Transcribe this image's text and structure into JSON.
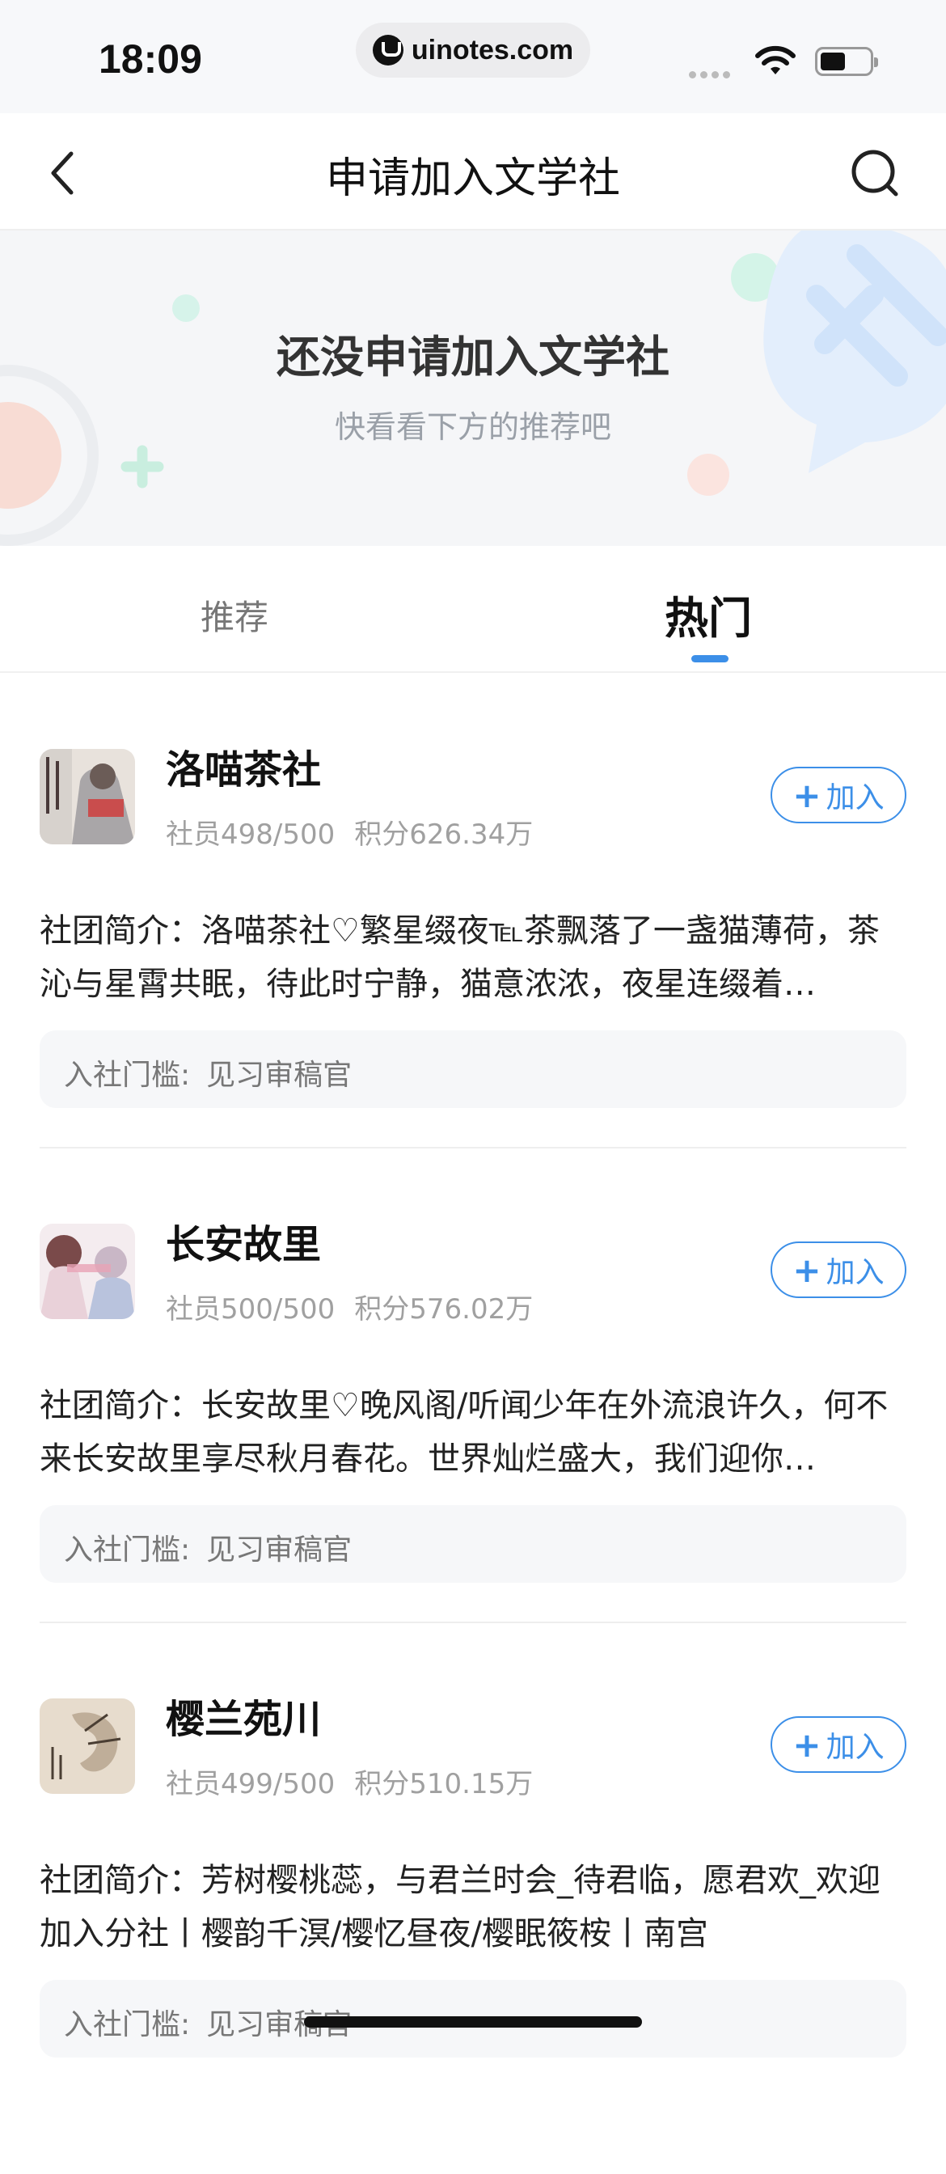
{
  "status_bar": {
    "time": "18:09",
    "url": "uinotes.com"
  },
  "nav": {
    "title": "申请加入文学社"
  },
  "banner": {
    "title": "还没申请加入文学社",
    "subtitle": "快看看下方的推荐吧"
  },
  "tabs": [
    {
      "label": "推荐",
      "active": false
    },
    {
      "label": "热门",
      "active": true
    }
  ],
  "join_label": "加入",
  "clubs": [
    {
      "name": "洛喵茶社",
      "members": "社员498/500",
      "points": "积分626.34万",
      "description": "社团简介：洛喵茶社♡繁星缀夜℡茶飘落了一盏猫薄荷，茶沁与星霄共眠，待此时宁静，猫意浓浓，夜星连缀着…",
      "threshold_label": "入社门槛:",
      "threshold_value": "见习审稿官"
    },
    {
      "name": "长安故里",
      "members": "社员500/500",
      "points": "积分576.02万",
      "description": "社团简介：长安故里♡晚风阁/听闻少年在外流浪许久，何不来长安故里享尽秋月春花。世界灿烂盛大，我们迎你…",
      "threshold_label": "入社门槛:",
      "threshold_value": "见习审稿官"
    },
    {
      "name": "樱兰苑川",
      "members": "社员499/500",
      "points": "积分510.15万",
      "description": "社团简介：芳树樱桃蕊，与君兰时会_待君临，愿君欢_欢迎加入分社丨樱韵千溟/樱忆昼夜/樱眠筱桉丨南宫",
      "threshold_label": "入社门槛:",
      "threshold_value": "见习审稿官"
    }
  ],
  "colors": {
    "accent": "#3c8fe8",
    "banner_bg": "#f5f6f8"
  }
}
